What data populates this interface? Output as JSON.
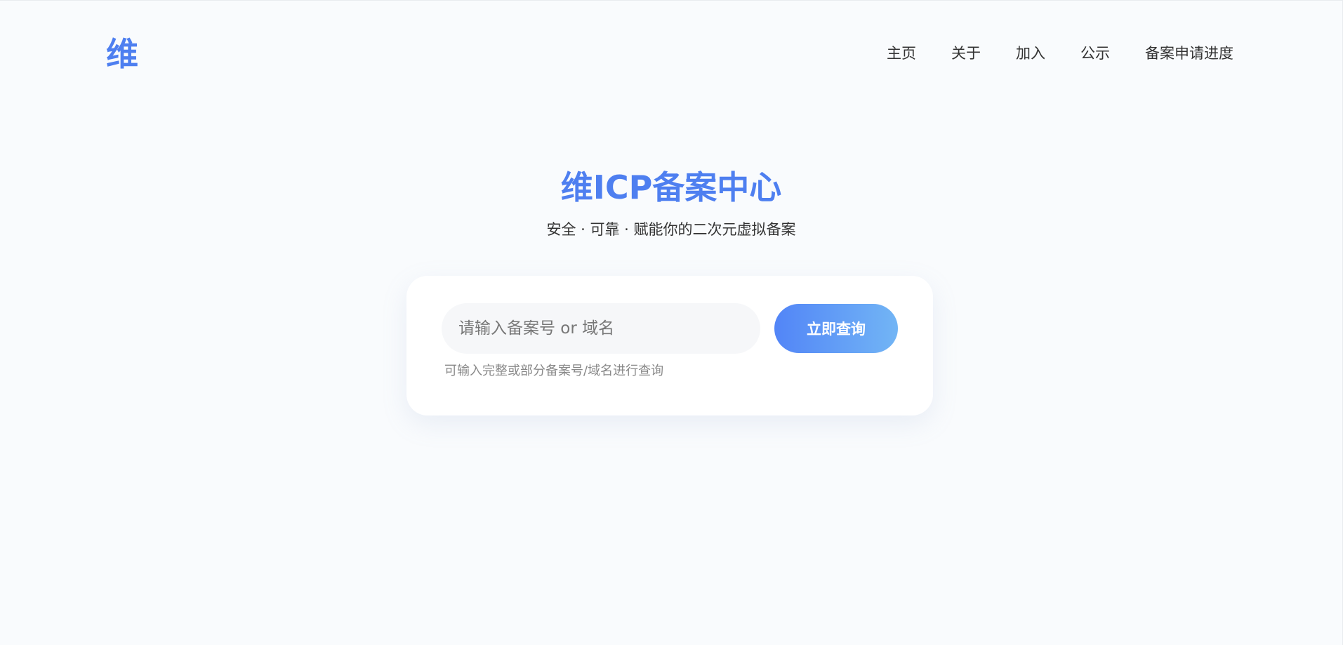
{
  "header": {
    "logo": "维",
    "nav": [
      {
        "label": "主页"
      },
      {
        "label": "关于"
      },
      {
        "label": "加入"
      },
      {
        "label": "公示"
      },
      {
        "label": "备案申请进度"
      }
    ]
  },
  "hero": {
    "title": "维ICP备案中心",
    "subtitle": "安全 · 可靠 · 赋能你的二次元虚拟备案"
  },
  "search": {
    "placeholder": "请输入备案号 or 域名",
    "value": "",
    "button_label": "立即查询",
    "hint": "可输入完整或部分备案号/域名进行查询"
  },
  "colors": {
    "accent": "#4e7ff0",
    "background": "#f9fbfd",
    "button_gradient_start": "#5285f7",
    "button_gradient_end": "#72b5f5"
  }
}
